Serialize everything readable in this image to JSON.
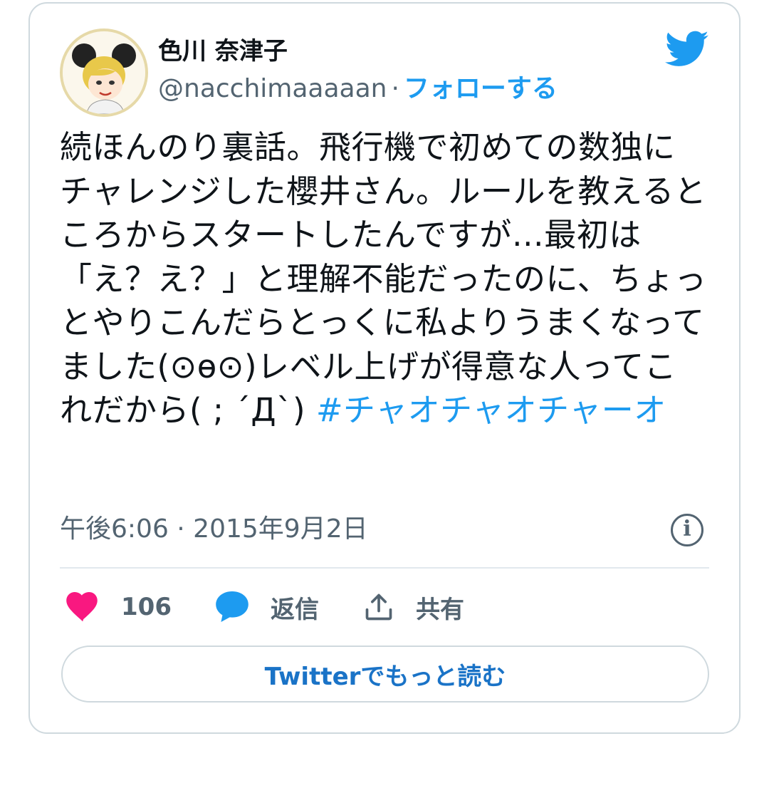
{
  "user": {
    "display_name": "色川 奈津子",
    "handle": "@nacchimaaaaan",
    "follow_label": "フォローする"
  },
  "tweet": {
    "text": "続ほんのり裏話。飛行機で初めての数独にチャレンジした櫻井さん。ルールを教えるところからスタートしたんですが…最初は「え？え？」と理解不能だったのに、ちょっとやりこんだらとっくに私よりうまくなってました(⊙ө⊙)レベル上げが得意な人ってこれだから( ; ´Д`) ",
    "hashtag": "#チャオチャオチャーオ",
    "timestamp": "午後6:06 · 2015年9月2日"
  },
  "actions": {
    "like_count": "106",
    "reply_label": "返信",
    "share_label": "共有"
  },
  "read_more_label": "Twitterでもっと読む",
  "colors": {
    "accent": "#1d9bf0",
    "heart": "#f91880",
    "muted": "#536471",
    "border": "#cfd9de"
  },
  "icons": {
    "brand": "twitter-bird-icon",
    "info": "info-icon",
    "like": "heart-icon",
    "reply": "speech-bubble-icon",
    "share": "share-upload-icon"
  }
}
